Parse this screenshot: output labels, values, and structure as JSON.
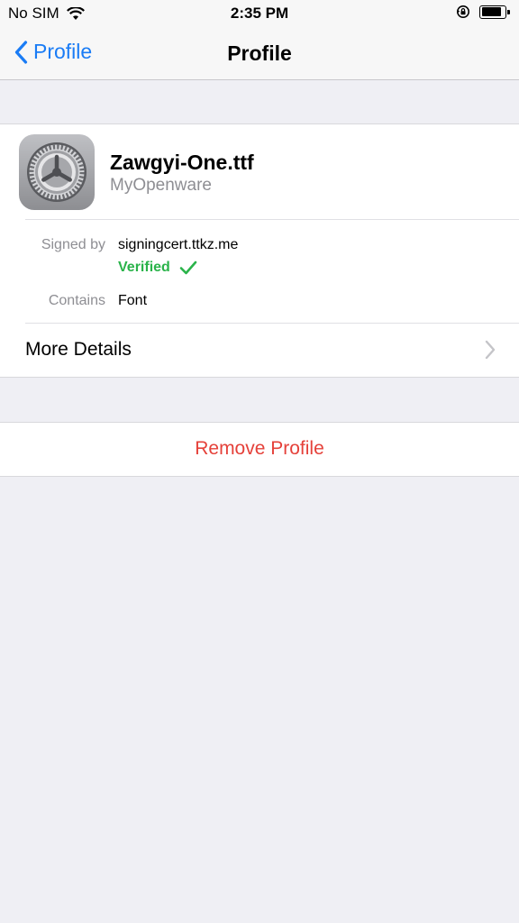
{
  "status_bar": {
    "carrier": "No SIM",
    "time": "2:35 PM",
    "battery_level": 0.85
  },
  "nav": {
    "back_label": "Profile",
    "title": "Profile"
  },
  "profile": {
    "name": "Zawgyi-One.ttf",
    "organization": "MyOpenware",
    "icon": "settings-gear-icon"
  },
  "details": {
    "signed_by_label": "Signed by",
    "signed_by_value": "signingcert.ttkz.me",
    "verified_label": "Verified",
    "contains_label": "Contains",
    "contains_value": "Font"
  },
  "more_details_label": "More Details",
  "remove_label": "Remove Profile",
  "colors": {
    "accent": "#1a7cf5",
    "verified": "#2ab34a",
    "destructive": "#e5413a"
  }
}
